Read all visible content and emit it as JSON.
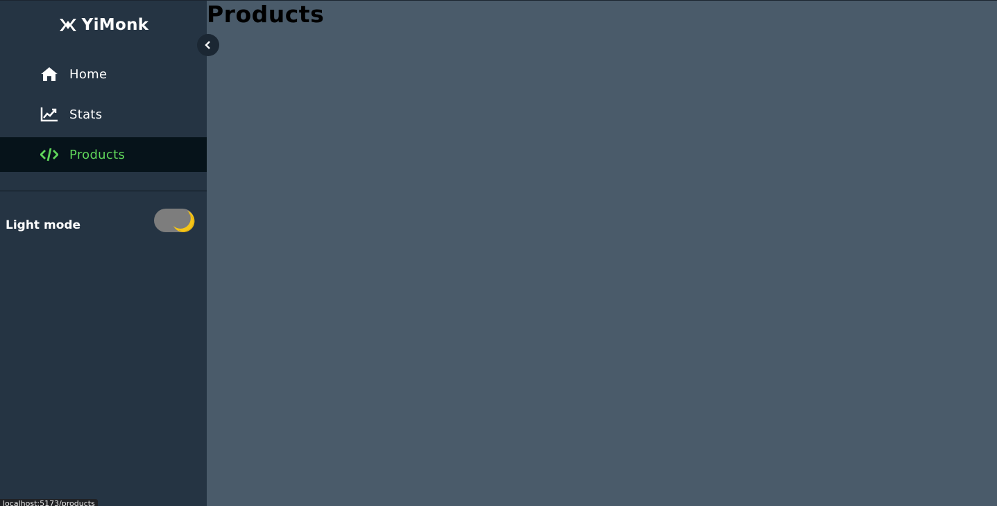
{
  "brand": {
    "name": "YiMonk",
    "logo_icon": "yimonk-logo-icon"
  },
  "sidebar": {
    "collapse_icon": "chevron-left-icon",
    "items": [
      {
        "label": "Home",
        "icon": "home-icon",
        "active": false
      },
      {
        "label": "Stats",
        "icon": "chart-line-icon",
        "active": false
      },
      {
        "label": "Products",
        "icon": "code-icon",
        "active": true
      }
    ],
    "theme": {
      "label": "Light mode",
      "toggle_icon": "moon-icon"
    }
  },
  "main": {
    "title": "Products"
  },
  "status_bar": {
    "url": "localhost:5173/products"
  },
  "colors": {
    "sidebar_bg": "#253443",
    "main_bg": "#4a5b6a",
    "active_bg": "#06131a",
    "active_text": "#5fd55a",
    "moon": "#f5c518"
  }
}
